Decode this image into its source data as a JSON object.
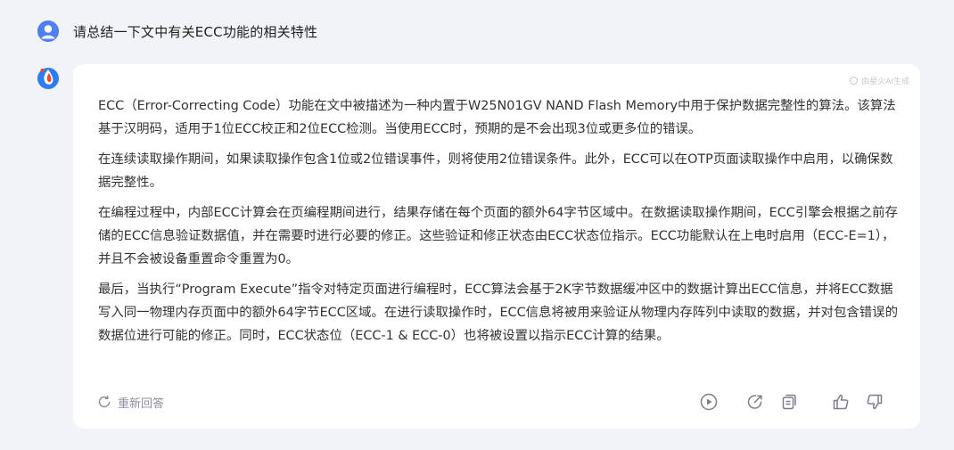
{
  "user": {
    "question": "请总结一下文中有关ECC功能的相关特性"
  },
  "answer": {
    "watermark": "由星火AI生成",
    "paragraphs": [
      "ECC（Error-Correcting Code）功能在文中被描述为一种内置于W25N01GV NAND Flash Memory中用于保护数据完整性的算法。该算法基于汉明码，适用于1位ECC校正和2位ECC检测。当使用ECC时，预期的是不会出现3位或更多位的错误。",
      "在连续读取操作期间，如果读取操作包含1位或2位错误事件，则将使用2位错误条件。此外，ECC可以在OTP页面读取操作中启用，以确保数据完整性。",
      "在编程过程中，内部ECC计算会在页编程期间进行，结果存储在每个页面的额外64字节区域中。在数据读取操作期间，ECC引擎会根据之前存储的ECC信息验证数据值，并在需要时进行必要的修正。这些验证和修正状态由ECC状态位指示。ECC功能默认在上电时启用（ECC-E=1），并且不会被设备重置命令重置为0。",
      "最后，当执行“Program Execute”指令对特定页面进行编程时，ECC算法会基于2K字节数据缓冲区中的数据计算出ECC信息，并将ECC数据写入同一物理内存页面中的额外64字节ECC区域。在进行读取操作时，ECC信息将被用来验证从物理内存阵列中读取的数据，并对包含错误的数据位进行可能的修正。同时，ECC状态位（ECC-1 & ECC-0）也将被设置以指示ECC计算的结果。"
    ],
    "regenerate_label": "重新回答"
  },
  "icons": {
    "user_avatar": "user-avatar-icon",
    "bot_avatar": "spark-logo-icon",
    "regenerate": "refresh-icon",
    "play": "play-icon",
    "share": "share-icon",
    "copy": "copy-icon",
    "like": "thumbs-up-icon",
    "dislike": "thumbs-down-icon"
  },
  "colors": {
    "background": "#f2f3f8",
    "card": "#ffffff",
    "accent": "#4f7ff0",
    "muted": "#8a8f99"
  }
}
